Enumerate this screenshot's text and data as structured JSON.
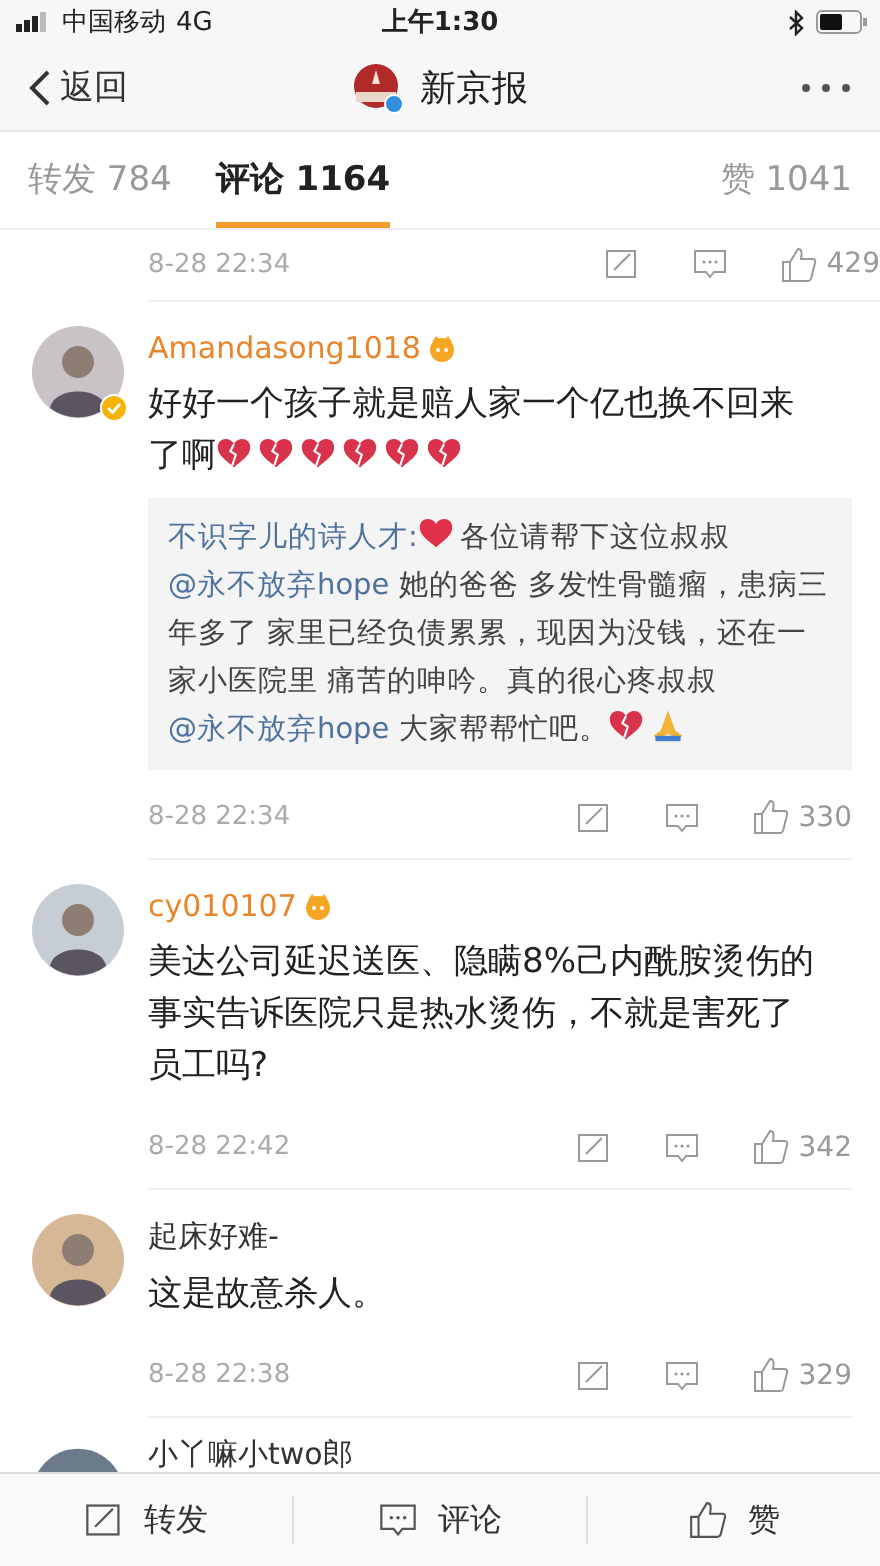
{
  "status_bar": {
    "carrier": "中国移动",
    "network": "4G",
    "time": "上午1:30"
  },
  "nav": {
    "back": "返回",
    "title": "新京报"
  },
  "tabs": [
    {
      "label": "转发 784",
      "selected": false
    },
    {
      "label": "评论 1164",
      "selected": true
    },
    {
      "label": "赞 1041",
      "selected": false
    }
  ],
  "top_actions": {
    "time": "8-28 22:34",
    "likes": "429"
  },
  "comments": [
    {
      "user": "Amandasong1018",
      "vip": true,
      "verified": true,
      "segments": [
        {
          "kind": "text",
          "text": "好好一个孩子就是赔人家一个亿也换不回来了啊"
        },
        {
          "kind": "broken-heart"
        },
        {
          "kind": "broken-heart"
        },
        {
          "kind": "broken-heart"
        },
        {
          "kind": "broken-heart"
        },
        {
          "kind": "broken-heart"
        },
        {
          "kind": "broken-heart"
        }
      ],
      "quote": {
        "author": "不识字儿的诗人才:",
        "segments": [
          {
            "kind": "heart"
          },
          {
            "kind": "text",
            "text": "各位请帮下这位叔叔"
          },
          {
            "kind": "mention",
            "text": "@永不放弃hope"
          },
          {
            "kind": "text",
            "text": " 她的爸爸 多发性骨髓瘤，患病三年多了 家里已经负债累累，现因为没钱，还在一家小医院里 痛苦的呻吟。真的很心疼叔叔"
          },
          {
            "kind": "mention",
            "text": "@永不放弃hope"
          },
          {
            "kind": "text",
            "text": " 大家帮帮忙吧。"
          },
          {
            "kind": "broken-heart"
          },
          {
            "kind": "pray"
          }
        ]
      },
      "time": "8-28 22:34",
      "likes": "330"
    },
    {
      "user": "cy010107",
      "vip": true,
      "verified": false,
      "segments": [
        {
          "kind": "text",
          "text": "美达公司延迟送医、隐瞒8%己内酰胺烫伤的事实告诉医院只是热水烫伤，不就是害死了员工吗?"
        }
      ],
      "time": "8-28 22:42",
      "likes": "342"
    },
    {
      "user": "起床好难-",
      "vip": false,
      "verified": false,
      "segments": [
        {
          "kind": "text",
          "text": "这是故意杀人。"
        }
      ],
      "time": "8-28 22:38",
      "likes": "329"
    }
  ],
  "partial_comment": {
    "user": "小丫嘛小two郎"
  },
  "bottom_bar": [
    {
      "kind": "repost",
      "label": "转发"
    },
    {
      "kind": "comment",
      "label": "评论"
    },
    {
      "kind": "like",
      "label": "赞"
    }
  ]
}
